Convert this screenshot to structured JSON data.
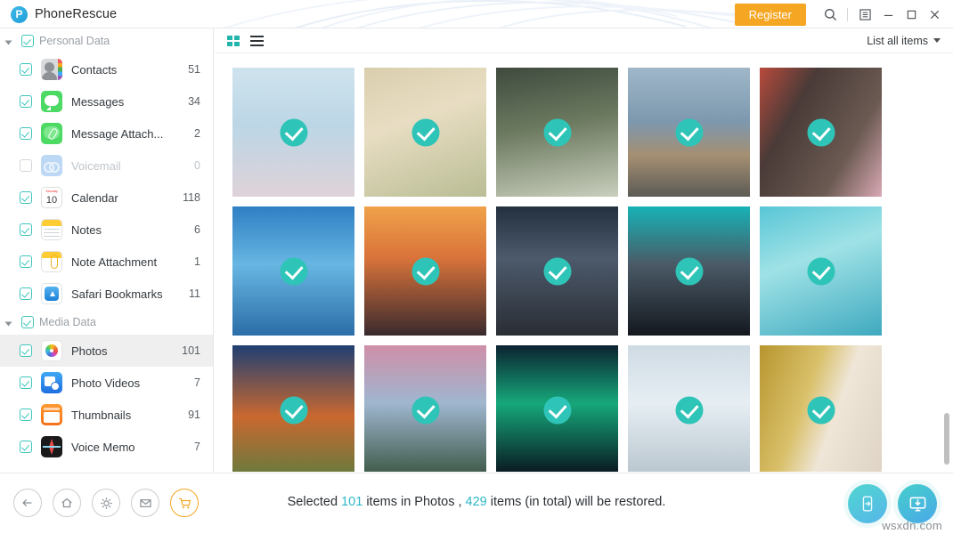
{
  "window": {
    "app_title": "PhoneRescue",
    "logo_icon": "phonerescue-logo-icon",
    "register_label": "Register",
    "search_icon": "search-icon",
    "menu_icon": "menu-icon",
    "minimize_icon": "minimize-icon",
    "maximize_icon": "maximize-icon",
    "close_icon": "close-icon",
    "accent_color": "#f5a623",
    "teal_color": "#2fc4b8"
  },
  "sidebar": {
    "groups": [
      {
        "label": "Personal Data",
        "checked": true,
        "expanded": true,
        "items": [
          {
            "label": "Contacts",
            "count": "51",
            "checked": true,
            "enabled": true,
            "icon": "contacts-icon",
            "icon_class": "ic-contacts"
          },
          {
            "label": "Messages",
            "count": "34",
            "checked": true,
            "enabled": true,
            "icon": "messages-icon",
            "icon_class": "ic-messages"
          },
          {
            "label": "Message Attach...",
            "count": "2",
            "checked": true,
            "enabled": true,
            "icon": "message-attachment-icon",
            "icon_class": "ic-msgattach"
          },
          {
            "label": "Voicemail",
            "count": "0",
            "checked": false,
            "enabled": false,
            "icon": "voicemail-icon",
            "icon_class": "ic-voicemail"
          },
          {
            "label": "Calendar",
            "count": "118",
            "checked": true,
            "enabled": true,
            "icon": "calendar-icon",
            "icon_class": "ic-calendar"
          },
          {
            "label": "Notes",
            "count": "6",
            "checked": true,
            "enabled": true,
            "icon": "notes-icon",
            "icon_class": "ic-notes"
          },
          {
            "label": "Note Attachment",
            "count": "1",
            "checked": true,
            "enabled": true,
            "icon": "note-attachment-icon",
            "icon_class": "ic-noteatt"
          },
          {
            "label": "Safari Bookmarks",
            "count": "11",
            "checked": true,
            "enabled": true,
            "icon": "safari-bookmarks-icon",
            "icon_class": "ic-safari"
          }
        ]
      },
      {
        "label": "Media Data",
        "checked": true,
        "expanded": true,
        "items": [
          {
            "label": "Photos",
            "count": "101",
            "checked": true,
            "enabled": true,
            "selected": true,
            "icon": "photos-icon",
            "icon_class": "ic-photos"
          },
          {
            "label": "Photo Videos",
            "count": "7",
            "checked": true,
            "enabled": true,
            "icon": "photo-videos-icon",
            "icon_class": "ic-photovid"
          },
          {
            "label": "Thumbnails",
            "count": "91",
            "checked": true,
            "enabled": true,
            "icon": "thumbnails-icon",
            "icon_class": "ic-thumb"
          },
          {
            "label": "Voice Memo",
            "count": "7",
            "checked": true,
            "enabled": true,
            "icon": "voice-memo-icon",
            "icon_class": "ic-voice"
          }
        ]
      }
    ]
  },
  "viewbar": {
    "grid_view_icon": "grid-view-icon",
    "list_view_icon": "list-view-icon",
    "active_view": "grid",
    "filter_label": "List all items",
    "filter_caret_icon": "chevron-down-icon"
  },
  "gallery": {
    "checkmark_icon": "checkmark-badge-icon",
    "columns": 5,
    "photos": [
      {
        "alt": "Yellow blossoms against pale blue sky",
        "selected": true
      },
      {
        "alt": "Dried cream-colored flowers close-up",
        "selected": true
      },
      {
        "alt": "Plant behind chain-link fence window",
        "selected": true
      },
      {
        "alt": "Desert highway toward mountain range",
        "selected": true
      },
      {
        "alt": "Pink blossoms near red temple pillar",
        "selected": true
      },
      {
        "alt": "Tiny-planet island panorama with clouds",
        "selected": true
      },
      {
        "alt": "Palm tree road at orange sunset",
        "selected": true
      },
      {
        "alt": "Night city street with neon lights",
        "selected": true
      },
      {
        "alt": "City skyline at dusk with teal clouds",
        "selected": true
      },
      {
        "alt": "Heart-shaped island in turquoise sea",
        "selected": true
      },
      {
        "alt": "Eiffel Tower at sunset",
        "selected": true
      },
      {
        "alt": "Pink clouds reflected over lake",
        "selected": true
      },
      {
        "alt": "Green aurora borealis over dark sky",
        "selected": true
      },
      {
        "alt": "Snow-covered forest in winter",
        "selected": true
      },
      {
        "alt": "Autumn leaves beside pale wall",
        "selected": true
      }
    ]
  },
  "bottom_bar": {
    "back_icon": "back-arrow-icon",
    "home_icon": "home-icon",
    "settings_icon": "gear-icon",
    "mail_icon": "mail-icon",
    "cart_icon": "shopping-cart-icon",
    "status_prefix": "Selected",
    "selected_count": "101",
    "status_middle": "items in Photos ,",
    "total_count": "429",
    "status_suffix": "items (in total) will be restored.",
    "restore_to_device_icon": "restore-to-device-icon",
    "restore_to_computer_icon": "restore-to-computer-icon"
  },
  "watermark": "wsxdn.com"
}
